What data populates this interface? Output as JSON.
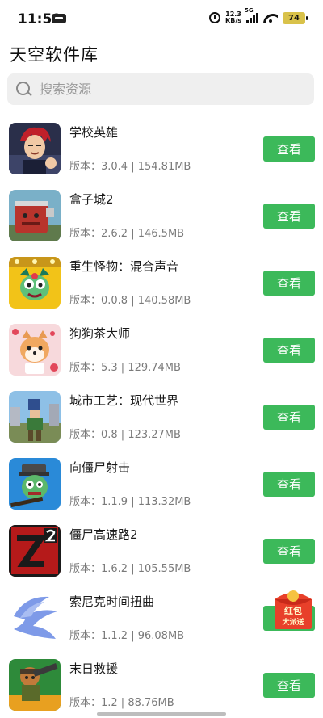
{
  "status_bar": {
    "time": "11:59",
    "net_speed_value": "12.3",
    "net_speed_unit": "KB/s",
    "network_type": "5G",
    "battery": "74"
  },
  "page": {
    "title": "天空软件库"
  },
  "search": {
    "placeholder": "搜索资源"
  },
  "apps": [
    {
      "name": "学校英雄",
      "meta": "版本：3.0.4 | 154.81MB",
      "button": "查看",
      "icon": "school-hero-icon"
    },
    {
      "name": "盒子城2",
      "meta": "版本：2.6.2 | 146.5MB",
      "button": "查看",
      "icon": "box-city-icon"
    },
    {
      "name": "重生怪物：混合声音",
      "meta": "版本：0.0.8 | 140.58MB",
      "button": "查看",
      "icon": "monster-icon"
    },
    {
      "name": "狗狗茶大师",
      "meta": "版本：5.3 | 129.74MB",
      "button": "查看",
      "icon": "dog-tea-icon"
    },
    {
      "name": "城市工艺：现代世界",
      "meta": "版本：0.8 | 123.27MB",
      "button": "查看",
      "icon": "city-craft-icon"
    },
    {
      "name": "向僵尸射击",
      "meta": "版本：1.1.9 | 113.32MB",
      "button": "查看",
      "icon": "zombie-shooter-icon"
    },
    {
      "name": "僵尸高速路2",
      "meta": "版本：1.6.2 | 105.55MB",
      "button": "查看",
      "icon": "zombie-highway-icon"
    },
    {
      "name": "索尼克时间扭曲",
      "meta": "版本：1.1.2 | 96.08MB",
      "button": "查看",
      "icon": "sonic-time-twisted-icon"
    },
    {
      "name": "末日救援",
      "meta": "版本：1.2 | 88.76MB",
      "button": "查看",
      "icon": "doomsday-rescue-icon"
    }
  ],
  "floating_badge": {
    "line1": "红包",
    "line2": "大派送"
  },
  "colors": {
    "accent_green": "#3cb95a",
    "search_bg": "#efefef",
    "meta_gray": "#7a7a7a"
  }
}
